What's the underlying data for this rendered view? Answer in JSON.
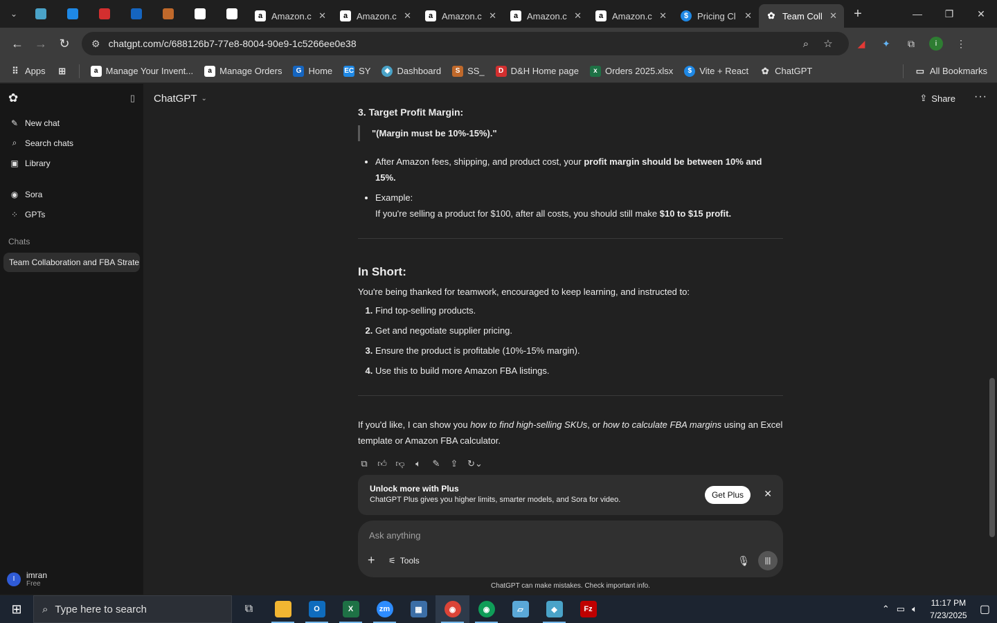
{
  "browser": {
    "tabs": [
      {
        "title": "Amazon.c",
        "favicon": "a"
      },
      {
        "title": "Amazon.c",
        "favicon": "a"
      },
      {
        "title": "Amazon.c",
        "favicon": "a"
      },
      {
        "title": "Amazon.c",
        "favicon": "a"
      },
      {
        "title": "Amazon.c",
        "favicon": "a"
      },
      {
        "title": "Pricing Cl",
        "favicon": "$"
      },
      {
        "title": "Team Coll",
        "favicon": "✿"
      }
    ],
    "url": "chatgpt.com/c/688126b7-77e8-8004-90e9-1c5266ee0e38",
    "bookmarks": [
      {
        "label": "Apps"
      },
      {
        "label": "Manage Your Invent..."
      },
      {
        "label": "Manage Orders"
      },
      {
        "label": "Home"
      },
      {
        "label": "SY"
      },
      {
        "label": "Dashboard"
      },
      {
        "label": "SS_"
      },
      {
        "label": "D&H Home page"
      },
      {
        "label": "Orders 2025.xlsx"
      },
      {
        "label": "Vite + React"
      },
      {
        "label": "ChatGPT"
      }
    ],
    "all_bookmarks": "All Bookmarks"
  },
  "sidebar": {
    "items": [
      {
        "label": "New chat"
      },
      {
        "label": "Search chats"
      },
      {
        "label": "Library"
      },
      {
        "label": "Sora"
      },
      {
        "label": "GPTs"
      }
    ],
    "chats_label": "Chats",
    "chats": [
      {
        "title": "Team Collaboration and FBA Strate..."
      }
    ],
    "user": {
      "initial": "I",
      "name": "imran",
      "plan": "Free"
    }
  },
  "header": {
    "model": "ChatGPT",
    "share": "Share"
  },
  "message": {
    "section3_title": "3. Target Profit Margin:",
    "quote": "\"(Margin must be 10%-15%).\"",
    "bullet1_pre": "After Amazon fees, shipping, and product cost, your ",
    "bullet1_bold": "profit margin should be between 10% and 15%.",
    "bullet2_label": "Example:",
    "bullet2_pre": "If you're selling a product for $100, after all costs, you should still make ",
    "bullet2_bold": "$10 to $15 profit",
    "bullet2_post": ".",
    "inshort_title": "In Short:",
    "inshort_intro": "You're being thanked for teamwork, encouraged to keep learning, and instructed to:",
    "steps": [
      "Find top-selling products.",
      "Get and negotiate supplier pricing.",
      "Ensure the product is profitable (10%-15% margin).",
      "Use this to build more Amazon FBA listings."
    ],
    "closing_pre": "If you'd like, I can show you ",
    "closing_em1": "how to find high-selling SKUs",
    "closing_mid": ", or ",
    "closing_em2": "how to calculate FBA margins",
    "closing_post": " using an Excel template or Amazon FBA calculator."
  },
  "banner": {
    "title": "Unlock more with Plus",
    "desc": "ChatGPT Plus gives you higher limits, smarter models, and Sora for video.",
    "button": "Get Plus"
  },
  "composer": {
    "placeholder": "Ask anything",
    "tools": "Tools"
  },
  "disclaimer": "ChatGPT can make mistakes. Check important info.",
  "taskbar": {
    "search_placeholder": "Type here to search",
    "time": "11:17 PM",
    "date": "7/23/2025"
  },
  "colors": {
    "background": "#212121",
    "sidebar": "#171717",
    "taskbar": "#1c2430"
  }
}
